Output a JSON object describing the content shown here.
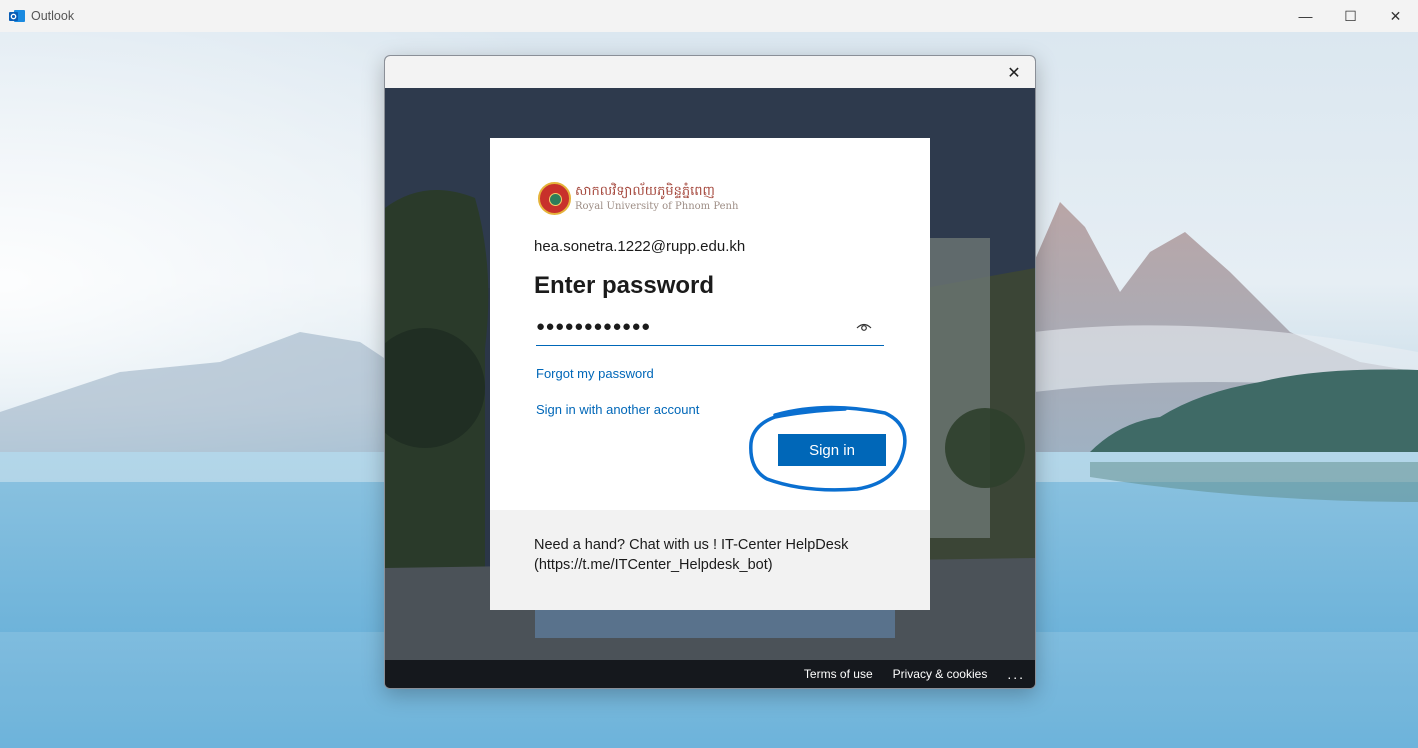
{
  "app": {
    "title": "Outlook",
    "controls": {
      "minimize": "—",
      "maximize": "☐",
      "close": "✕"
    }
  },
  "dialog": {
    "close_glyph": "✕",
    "logo": {
      "khmer_text": "សាកលវិទ្យាល័យភូមិន្ទភ្នំពេញ",
      "english_text": "Royal University of Phnom Penh"
    },
    "email": "hea.sonetra.1222@rupp.edu.kh",
    "heading": "Enter password",
    "password": {
      "masked_value": "●●●●●●●●●●●●",
      "reveal_icon": "eye-icon"
    },
    "links": {
      "forgot": "Forgot my password",
      "other_account": "Sign in with another account"
    },
    "sign_in_button": "Sign in",
    "help_text": "Need a hand? Chat with us ! IT-Center HelpDesk (https://t.me/ITCenter_Helpdesk_bot)",
    "footer": {
      "terms": "Terms of use",
      "privacy": "Privacy & cookies",
      "more": "..."
    }
  },
  "colors": {
    "accent": "#0067b8",
    "annotation": "#0a6fd0",
    "footer_bg": "#15181d"
  }
}
